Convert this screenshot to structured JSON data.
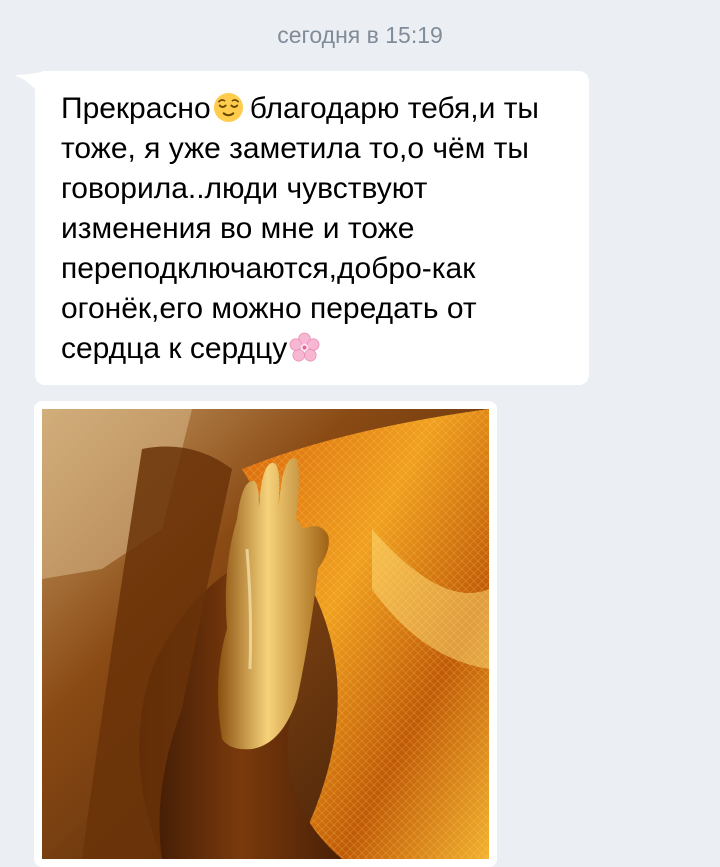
{
  "chat": {
    "date_separator": "сегодня в 15:19",
    "message": {
      "line1_before_emoji": "Прекрасно",
      "line1_after_emoji": "благодарю тебя,и",
      "rest": "ты тоже, я уже заметила то,о чём ты говорила..люди чувствуют изменения во мне и тоже переподключаются,добро-как огонёк,его можно передать от сердца к сердцу",
      "emoji_1": "relieved-face-emoji",
      "emoji_2": "cherry-blossom-emoji"
    },
    "attachment": {
      "type": "photo",
      "icon": "buddha-hand-photo"
    }
  },
  "colors": {
    "background": "#ebeef2",
    "bubble": "#ffffff",
    "date_text": "#818c99",
    "message_text": "#000000"
  }
}
